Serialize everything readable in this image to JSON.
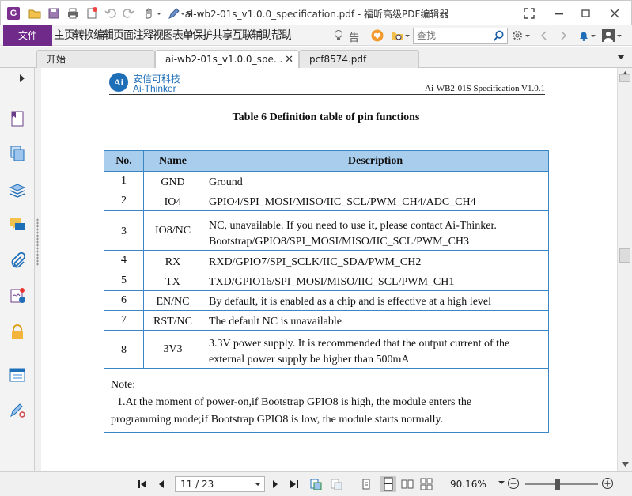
{
  "window": {
    "title": "ai-wb2-01s_v1.0.0_specification.pdf - 福昕高级PDF编辑器"
  },
  "ribbon": {
    "file_label": "文件",
    "menu_items": [
      "主页",
      "转换",
      "编辑",
      "页面",
      "注释",
      "视图",
      "表单",
      "保护",
      "共享",
      "互联",
      "辅助",
      "帮助"
    ],
    "tell_me": "告",
    "search_placeholder": "查找"
  },
  "tabs": [
    {
      "label": "开始",
      "active": false
    },
    {
      "label": "ai-wb2-01s_v1.0.0_spe...",
      "active": true
    },
    {
      "label": "pcf8574.pdf",
      "active": false
    }
  ],
  "document": {
    "logo_mark": "Ai",
    "logo_cn": "安信可科技",
    "logo_en": "Ai-Thinker",
    "header_spec": "Ai-WB2-01S Specification  V1.0.1",
    "table_title": "Table 6 Definition table of pin functions",
    "table": {
      "headers": [
        "No.",
        "Name",
        "Description"
      ],
      "rows": [
        {
          "no": "1",
          "name": "GND",
          "desc": [
            "Ground"
          ]
        },
        {
          "no": "2",
          "name": "IO4",
          "desc": [
            "GPIO4/SPI_MOSI/MISO/IIC_SCL/PWM_CH4/ADC_CH4"
          ]
        },
        {
          "no": "3",
          "name": "IO8/NC",
          "desc": [
            "NC, unavailable. If you need to use it, please contact Ai-Thinker.",
            "Bootstrap/GPIO8/SPI_MOSI/MISO/IIC_SCL/PWM_CH3"
          ]
        },
        {
          "no": "4",
          "name": "RX",
          "desc": [
            "RXD/GPIO7/SPI_SCLK/IIC_SDA/PWM_CH2"
          ]
        },
        {
          "no": "5",
          "name": "TX",
          "desc": [
            "TXD/GPIO16/SPI_MOSI/MISO/IIC_SCL/PWM_CH1"
          ]
        },
        {
          "no": "6",
          "name": "EN/NC",
          "desc": [
            "By default, it is enabled as a chip and is effective at a high level"
          ]
        },
        {
          "no": "7",
          "name": "RST/NC",
          "desc": [
            "The default NC is unavailable"
          ]
        },
        {
          "no": "8",
          "name": "3V3",
          "desc": [
            "3.3V power supply. It is recommended that the output current of the",
            "external power supply be higher than 500mA"
          ]
        }
      ],
      "note_title": "Note:",
      "note_line1": "1.At the moment of power-on,if Bootstrap GPIO8 is high, the module enters the",
      "note_line2": "programming mode;if Bootstrap GPIO8 is low, the module starts normally."
    }
  },
  "statusbar": {
    "page_indicator": "11 / 23",
    "zoom": "90.16%",
    "zoom_slider_fraction": 0.45
  },
  "colors": {
    "brand": "#6f2a8a",
    "table_header": "#a9cdec",
    "table_border": "#3a86c4",
    "logo_blue": "#1f6fb8"
  }
}
